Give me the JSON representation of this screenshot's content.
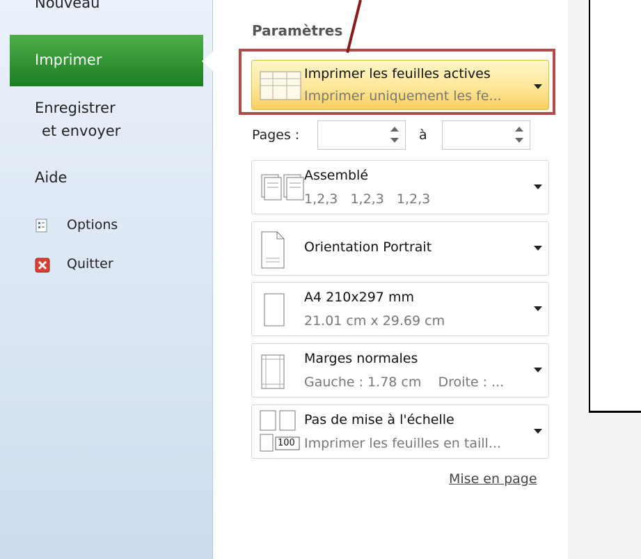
{
  "sidebar": {
    "items": [
      {
        "label": "Nouveau"
      },
      {
        "label": "Imprimer"
      },
      {
        "label": "Enregistrer"
      },
      {
        "label": "et envoyer"
      },
      {
        "label": "Aide"
      },
      {
        "label": "Options"
      },
      {
        "label": "Quitter"
      }
    ]
  },
  "settings": {
    "title": "Paramètres",
    "print_what": {
      "line1": "Imprimer les feuilles actives",
      "line2": "Imprimer uniquement les fe..."
    },
    "pages_label": "Pages :",
    "to_label": "à",
    "pages_from_value": "",
    "pages_to_value": "",
    "collate": {
      "line1": "Assemblé",
      "line2": "1,2,3   1,2,3   1,2,3"
    },
    "orientation": {
      "line1": "Orientation Portrait"
    },
    "paper": {
      "line1": "A4 210x297 mm",
      "line2": "21.01 cm x 29.69 cm"
    },
    "margins": {
      "line1": "Marges normales",
      "line2": "Gauche : 1.78 cm    Droite : ..."
    },
    "scaling": {
      "line1": "Pas de mise à l'échelle",
      "line2": "Imprimer les feuilles en taill...",
      "icon_text": "100"
    },
    "page_setup_link": "Mise en page"
  },
  "colors": {
    "active_nav": "#2f8f2f",
    "highlight": "#b24a4a"
  }
}
